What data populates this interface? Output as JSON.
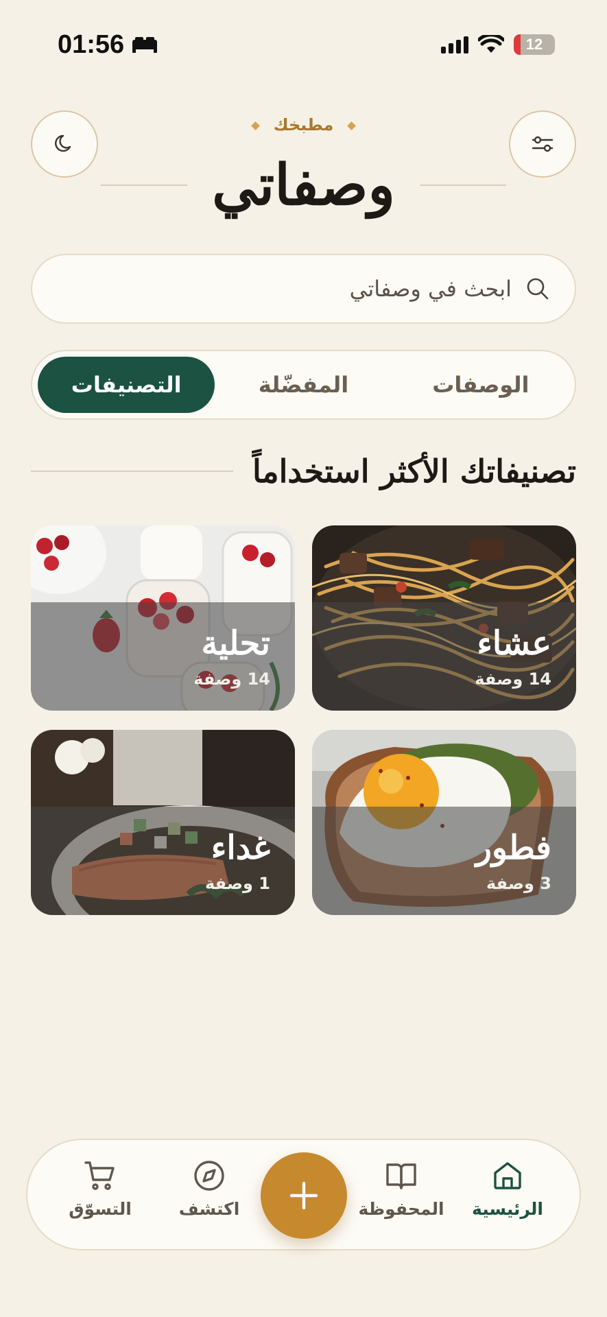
{
  "status_bar": {
    "time": "01:56",
    "battery": "12"
  },
  "header": {
    "kicker": "مطبخك",
    "title": "وصفاتي"
  },
  "search": {
    "placeholder": "ابحث في وصفاتي"
  },
  "tabs": [
    {
      "label": "الوصفات",
      "active": false
    },
    {
      "label": "المفضّلة",
      "active": false
    },
    {
      "label": "التصنيفات",
      "active": true
    }
  ],
  "section": {
    "title": "تصنيفاتك الأكثر استخداماً"
  },
  "categories": [
    {
      "title": "عشاء",
      "count": "14 وصفة",
      "image": "pasta-steak-photo"
    },
    {
      "title": "تحلية",
      "count": "14 وصفة",
      "image": "strawberry-dessert-photo"
    },
    {
      "title": "فطور",
      "count": "3 وصفة",
      "image": "egg-toast-photo"
    },
    {
      "title": "غداء",
      "count": "1 وصفة",
      "image": "salmon-plate-photo"
    }
  ],
  "nav": {
    "home": "الرئيسية",
    "saved": "المحفوظة",
    "explore": "اكتشف",
    "shopping": "التسوّق"
  },
  "colors": {
    "background": "#f6f1e7",
    "primary_green": "#1b5241",
    "accent_gold": "#c6892e"
  }
}
